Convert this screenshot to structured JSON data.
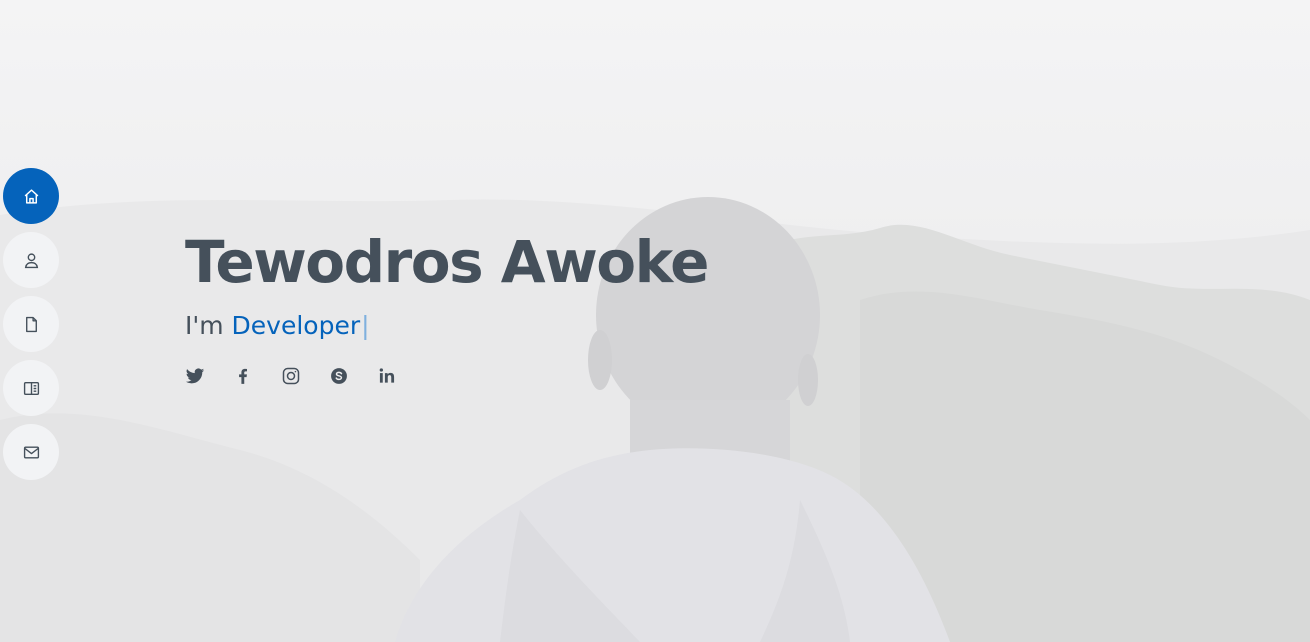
{
  "hero": {
    "name": "Tewodros Awoke",
    "tagline_prefix": "I'm ",
    "tagline_role": "Developer",
    "tagline_cursor": "|"
  },
  "nav": {
    "items": [
      {
        "icon": "home-icon",
        "active": true
      },
      {
        "icon": "user-icon",
        "active": false
      },
      {
        "icon": "file-icon",
        "active": false
      },
      {
        "icon": "book-icon",
        "active": false
      },
      {
        "icon": "mail-icon",
        "active": false
      }
    ]
  },
  "social": {
    "items": [
      {
        "icon": "twitter-icon"
      },
      {
        "icon": "facebook-icon"
      },
      {
        "icon": "instagram-icon"
      },
      {
        "icon": "skype-icon"
      },
      {
        "icon": "linkedin-icon"
      }
    ]
  },
  "colors": {
    "accent": "#0563bb",
    "text": "#45505b",
    "nav_bg": "#f2f3f5"
  }
}
